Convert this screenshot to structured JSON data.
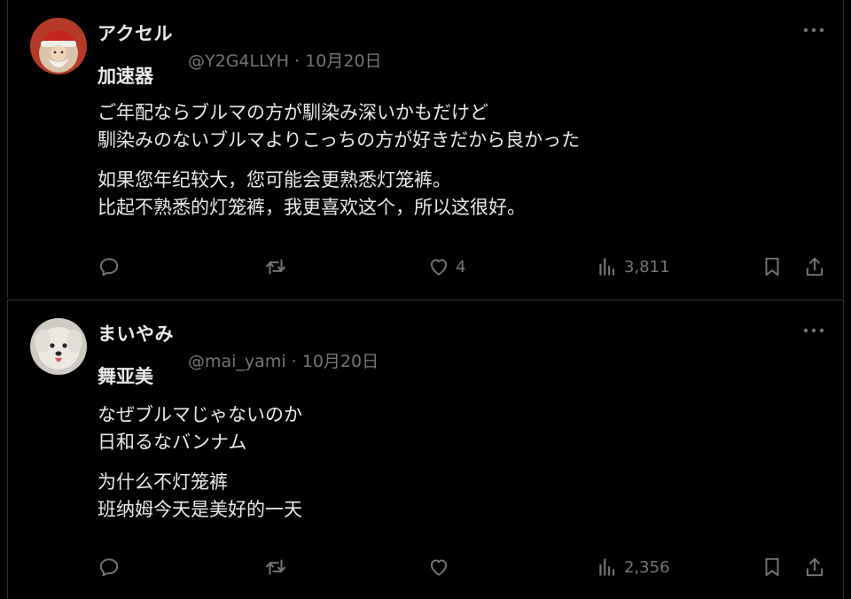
{
  "tweets": [
    {
      "display_name": "アクセル",
      "nickname": "加速器",
      "handle": "@Y2G4LLYH",
      "separator": "·",
      "date": "10月20日",
      "more_label": "···",
      "paragraphs": [
        [
          "ご年配ならブルマの方が馴染み深いかもだけど",
          "馴染みのないブルマよりこっちの方が好きだから良かった"
        ],
        [
          "如果您年纪较大，您可能会更熟悉灯笼裤。",
          "比起不熟悉的灯笼裤，我更喜欢这个，所以这很好。"
        ]
      ],
      "likes": "4",
      "views": "3,811",
      "avatar_icon": "santa-avatar"
    },
    {
      "display_name": "まいやみ",
      "nickname": "舞亚美",
      "handle": "@mai_yami",
      "separator": "·",
      "date": "10月20日",
      "more_label": "···",
      "paragraphs": [
        [
          "なぜブルマじゃないのか",
          "日和るなバンナム"
        ],
        [
          "为什么不灯笼裤",
          "班纳姆今天是美好的一天"
        ]
      ],
      "likes": "",
      "views": "2,356",
      "avatar_icon": "dog-avatar"
    }
  ],
  "icons": {
    "reply": "reply-icon",
    "retweet": "retweet-icon",
    "like": "heart-icon",
    "views": "views-icon",
    "bookmark": "bookmark-icon",
    "share": "share-icon"
  },
  "colors": {
    "background": "#000000",
    "text": "#e7e9ea",
    "muted": "#71767b",
    "divider": "#2f3336"
  }
}
